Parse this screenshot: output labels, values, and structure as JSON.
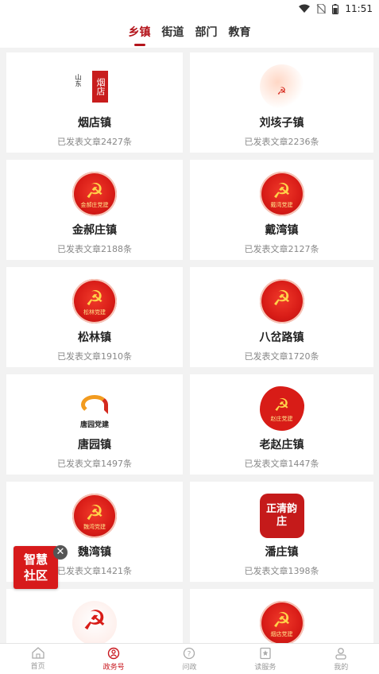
{
  "status": {
    "time": "11:51"
  },
  "tabs": [
    {
      "label": "乡镇",
      "active": true
    },
    {
      "label": "街道",
      "active": false
    },
    {
      "label": "部门",
      "active": false
    },
    {
      "label": "教育",
      "active": false
    }
  ],
  "cards": [
    {
      "name": "烟店镇",
      "count": "已发表文章2427条",
      "logo_text": "烟店",
      "logo_sub": "山东"
    },
    {
      "name": "刘垓子镇",
      "count": "已发表文章2236条",
      "logo_text": ""
    },
    {
      "name": "金郝庄镇",
      "count": "已发表文章2188条",
      "logo_text": "金郝庄党建"
    },
    {
      "name": "戴湾镇",
      "count": "已发表文章2127条",
      "logo_text": "戴湾党建"
    },
    {
      "name": "松林镇",
      "count": "已发表文章1910条",
      "logo_text": "松林党建"
    },
    {
      "name": "八岔路镇",
      "count": "已发表文章1720条",
      "logo_text": ""
    },
    {
      "name": "唐园镇",
      "count": "已发表文章1497条",
      "logo_text": "唐园党建"
    },
    {
      "name": "老赵庄镇",
      "count": "已发表文章1447条",
      "logo_text": "赵庄党建"
    },
    {
      "name": "魏湾镇",
      "count": "已发表文章1421条",
      "logo_text": "魏湾党建"
    },
    {
      "name": "潘庄镇",
      "count": "已发表文章1398条",
      "logo_text": "正清韵庄"
    },
    {
      "name": "",
      "count": "",
      "logo_text": ""
    },
    {
      "name": "",
      "count": "",
      "logo_text": "烟店党建"
    }
  ],
  "floating": {
    "line1": "智慧",
    "line2": "社区",
    "close": "✕"
  },
  "nav": [
    {
      "label": "首页",
      "icon": "home-icon",
      "active": false
    },
    {
      "label": "政务号",
      "icon": "gov-account-icon",
      "active": true
    },
    {
      "label": "问政",
      "icon": "question-icon",
      "active": false
    },
    {
      "label": "读服务",
      "icon": "service-icon",
      "active": false
    },
    {
      "label": "我的",
      "icon": "profile-icon",
      "active": false
    }
  ],
  "colors": {
    "accent": "#b4141b",
    "party_red": "#d81c17",
    "gold": "#ffd34a"
  }
}
